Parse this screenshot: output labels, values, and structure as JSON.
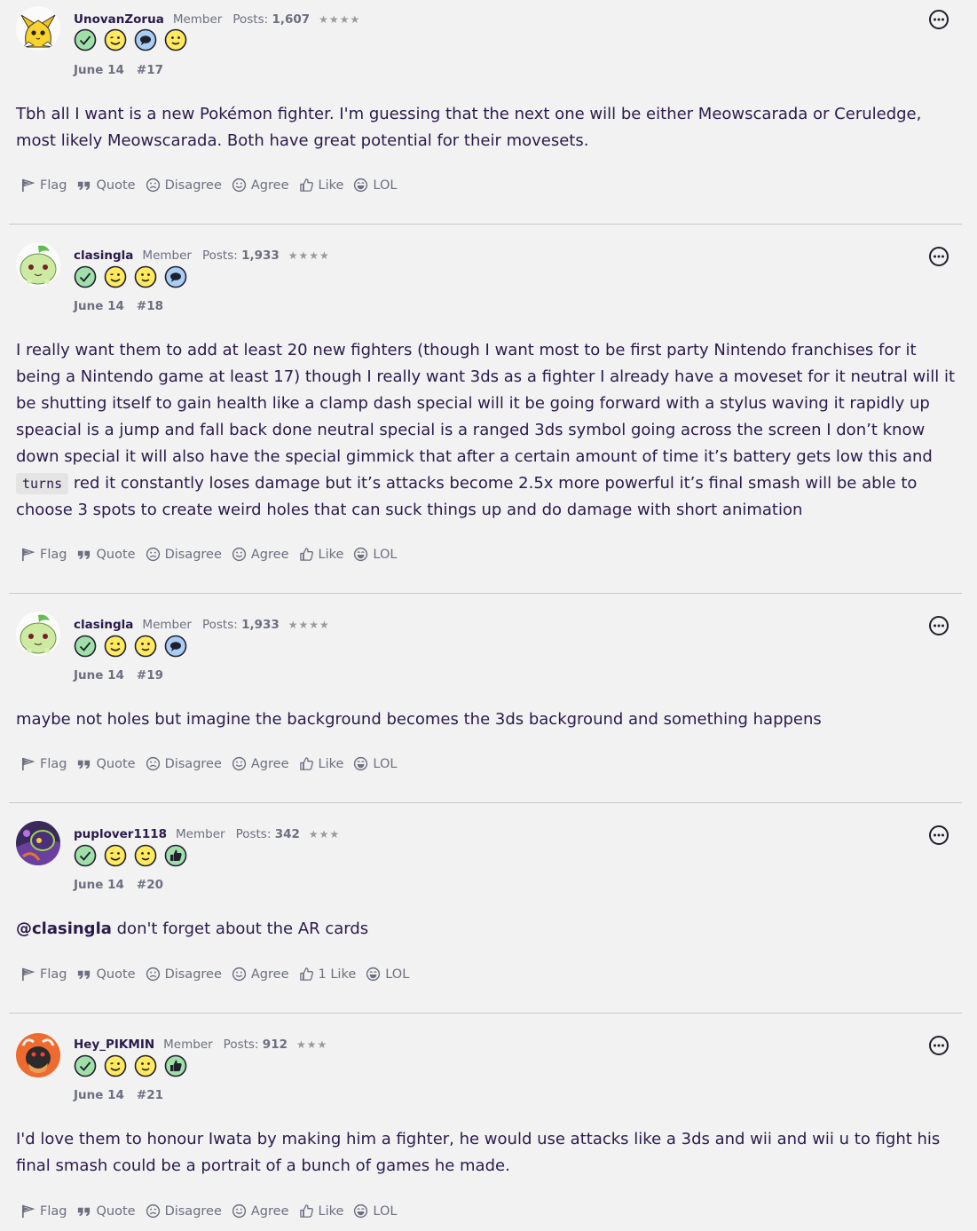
{
  "posts": [
    {
      "username": "UnovanZorua",
      "role": "Member",
      "posts_label": "Posts:",
      "posts_count": "1,607",
      "stars": "★★★★",
      "date": "June 14",
      "number": "#17",
      "content": "Tbh all I want is a new Pokémon fighter. I'm guessing that the next one will be either Meowscarada or Ceruledge, most likely Meowscarada. Both have great potential for their movesets.",
      "like_label": "Like"
    },
    {
      "username": "clasingla",
      "role": "Member",
      "posts_label": "Posts:",
      "posts_count": "1,933",
      "stars": "★★★★",
      "date": "June 14",
      "number": "#18",
      "content_before": "I really want them to add at least 20 new fighters (though I want most to be first party Nintendo franchises for it being a Nintendo game at least 17) though I really want 3ds as a fighter I already have a moveset for it neutral will it be shutting itself to gain health like a clamp dash special will it be going forward with a stylus waving it rapidly up speacial is a jump and fall back done neutral special is a ranged 3ds symbol going across the screen I don’t know down special it will also have the special gimmick that after a certain amount of time it’s battery gets low this and",
      "content_code": "turns",
      "content_after": "red it constantly loses damage but it’s attacks become 2.5x more powerful it’s final smash will be able to choose 3 spots to create weird holes that can suck things up and do damage with short animation",
      "like_label": "Like"
    },
    {
      "username": "clasingla",
      "role": "Member",
      "posts_label": "Posts:",
      "posts_count": "1,933",
      "stars": "★★★★",
      "date": "June 14",
      "number": "#19",
      "content": "maybe not holes but imagine the background becomes the 3ds background and something happens",
      "like_label": "Like"
    },
    {
      "username": "puplover1118",
      "role": "Member",
      "posts_label": "Posts:",
      "posts_count": "342",
      "stars": "★★★",
      "date": "June 14",
      "number": "#20",
      "mention": "@clasingla",
      "content": "don't forget about the AR cards",
      "like_label": "1 Like"
    },
    {
      "username": "Hey_PIKMIN",
      "role": "Member",
      "posts_label": "Posts:",
      "posts_count": "912",
      "stars": "★★★",
      "date": "June 14",
      "number": "#21",
      "content": "I'd love them to honour Iwata by making him a fighter, he would use attacks like a 3ds and wii and wii u to fight his final smash could be a portrait of a bunch of games he made.",
      "like_label": "Like"
    }
  ],
  "actions": {
    "flag": "Flag",
    "quote": "Quote",
    "disagree": "Disagree",
    "agree": "Agree",
    "lol": "LOL"
  },
  "icons": {
    "badge_check": "check-badge-icon",
    "badge_wink": "wink-badge-icon",
    "badge_chat": "chat-badge-icon",
    "badge_smile": "smile-badge-icon",
    "badge_thumb": "thumbs-up-badge-icon",
    "more": "more-options-icon"
  },
  "colors": {
    "text": "#2a1b4a",
    "muted": "#6c6f80",
    "bg": "#f2f2f2",
    "badge_green": "#9fe0a8",
    "badge_yellow": "#ffe95c",
    "badge_blue": "#a9cdf5"
  }
}
